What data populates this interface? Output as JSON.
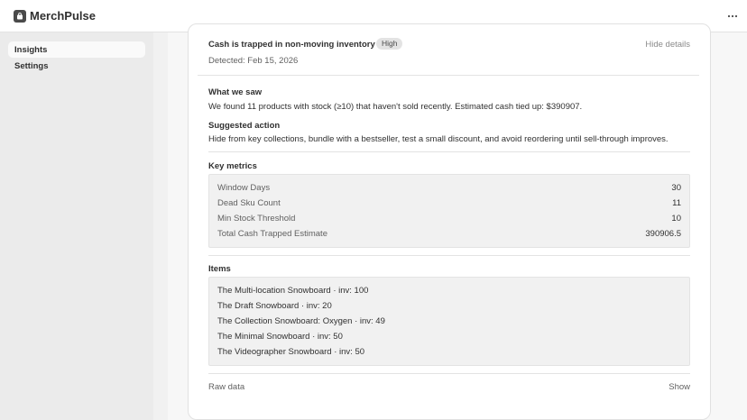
{
  "app": {
    "title": "MerchPulse"
  },
  "sidebar": {
    "items": [
      {
        "label": "Insights"
      },
      {
        "label": "Settings"
      }
    ]
  },
  "insight": {
    "title": "Cash is trapped in non-moving inventory",
    "severity": "High",
    "hide_details_label": "Hide details",
    "detected": "Detected: Feb 15, 2026",
    "what_we_saw_label": "What we saw",
    "what_we_saw": "We found 11 products with stock (≥10) that haven't sold recently. Estimated cash tied up: $390907.",
    "suggested_action_label": "Suggested action",
    "suggested_action": "Hide from key collections, bundle with a bestseller, test a small discount, and avoid reordering until sell-through improves.",
    "key_metrics_label": "Key metrics",
    "metrics": [
      {
        "label": "Window Days",
        "value": "30"
      },
      {
        "label": "Dead Sku Count",
        "value": "11"
      },
      {
        "label": "Min Stock Threshold",
        "value": "10"
      },
      {
        "label": "Total Cash Trapped Estimate",
        "value": "390906.5"
      }
    ],
    "items_label": "Items",
    "items": [
      "The Multi-location Snowboard · inv: 100",
      "The Draft Snowboard · inv: 20",
      "The Collection Snowboard: Oxygen · inv: 49",
      "The Minimal Snowboard · inv: 50",
      "The Videographer Snowboard · inv: 50"
    ],
    "raw_data_label": "Raw data",
    "show_label": "Show"
  },
  "icons": {
    "app_logo": "bag-icon",
    "menu": "more-horizontal-icon"
  },
  "colors": {
    "background": "#f1f1f1",
    "sidebar": "#ebebeb",
    "card": "#ffffff",
    "badge": "#e3e3e3",
    "text": "#303030",
    "muted_text": "#616161"
  }
}
